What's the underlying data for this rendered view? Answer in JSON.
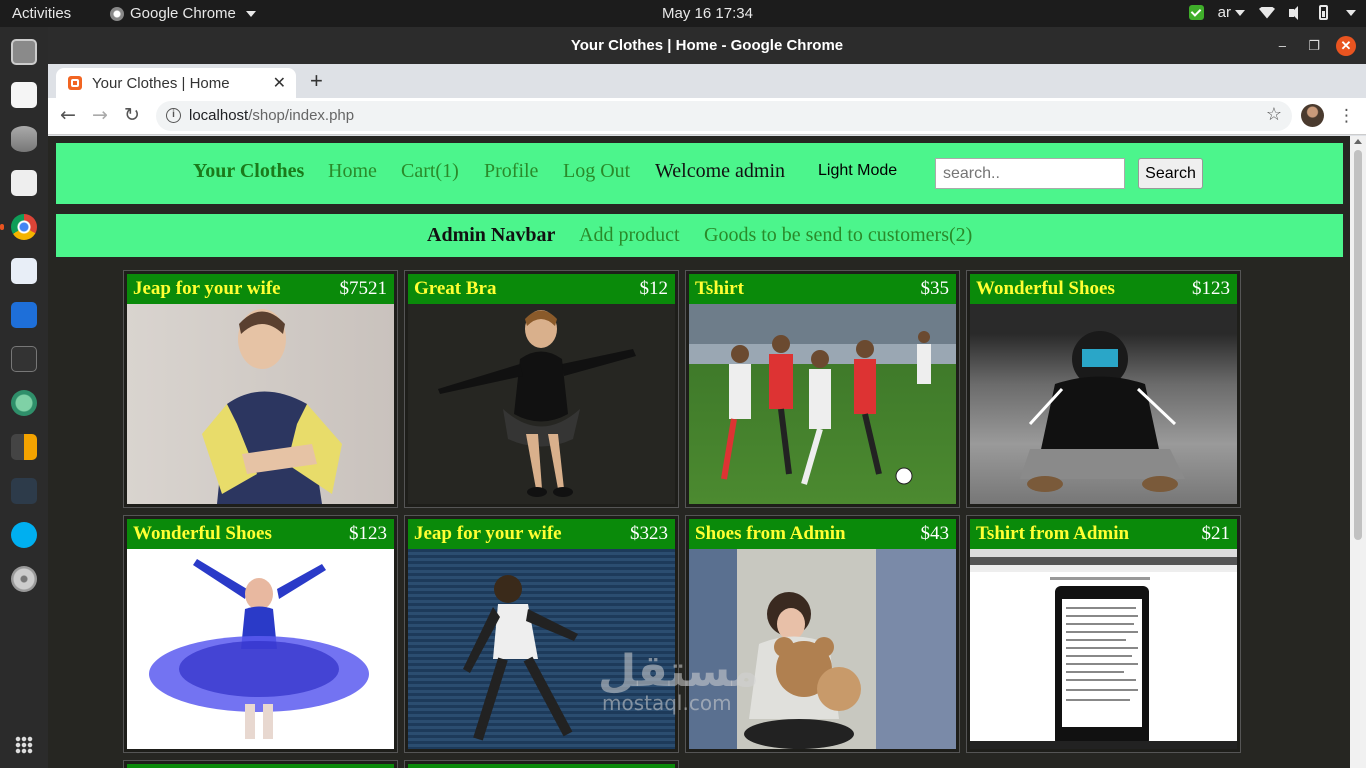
{
  "topbar": {
    "activities": "Activities",
    "app_name": "Google Chrome",
    "clock": "May 16  17:34",
    "input_source": "ar"
  },
  "window": {
    "title": "Your Clothes | Home - Google Chrome",
    "minimize": "–",
    "maximize": "❐",
    "close": "✕"
  },
  "browser": {
    "tab_title": "Your Clothes | Home",
    "tab_close": "✕",
    "new_tab": "+",
    "url_host": "localhost",
    "url_path": "/shop/index.php"
  },
  "navbar": {
    "brand": "Your Clothes",
    "home": "Home",
    "cart": "Cart(1)",
    "profile": "Profile",
    "logout": "Log Out",
    "welcome": "Welcome admin",
    "light_mode": "Light Mode",
    "search_placeholder": "search..",
    "search_button": "Search"
  },
  "admin_navbar": {
    "title": "Admin Navbar",
    "add_product": "Add product",
    "goods_to_send": "Goods to be send to customers(2)"
  },
  "products": [
    {
      "name": "Jeap for your wife",
      "price": "$7521"
    },
    {
      "name": "Great Bra",
      "price": "$12"
    },
    {
      "name": "Tshirt",
      "price": "$35"
    },
    {
      "name": "Wonderful Shoes",
      "price": "$123"
    },
    {
      "name": "Wonderful Shoes",
      "price": "$123"
    },
    {
      "name": "Jeap for your wife",
      "price": "$323"
    },
    {
      "name": "Shoes from Admin",
      "price": "$43"
    },
    {
      "name": "Tshirt from Admin",
      "price": "$21"
    }
  ],
  "watermark": {
    "line1": "مستقل",
    "line2": "mostaql.com"
  },
  "colors": {
    "navbar_bg": "#4cf58c",
    "card_header_bg": "#0a8a0a",
    "card_title": "#ffff33",
    "page_bg": "#262622"
  }
}
